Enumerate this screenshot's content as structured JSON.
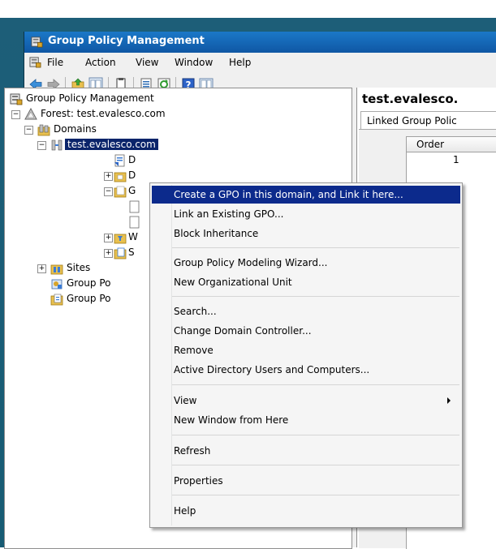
{
  "window": {
    "title": "Group Policy Management"
  },
  "menubar": {
    "items": [
      "File",
      "Action",
      "View",
      "Window",
      "Help"
    ]
  },
  "toolbar": {
    "buttons": [
      "back-icon",
      "forward-icon",
      "up-folder-icon",
      "show-hide-tree-icon",
      "clipboard-icon",
      "export-list-icon",
      "refresh-icon",
      "help-icon",
      "show-action-pane-icon"
    ]
  },
  "tree": {
    "root": "Group Policy Management",
    "forest": "Forest: test.evalesco.com",
    "domains": "Domains",
    "domain_selected": "test.evalesco.com",
    "child1": "D",
    "child2": "D",
    "child3": "G",
    "child6": "W",
    "child7": "S",
    "sites": "Sites",
    "gp_modeling": "Group Po",
    "gp_results": "Group Po"
  },
  "right_pane": {
    "title": "test.evalesco.",
    "tab": "Linked Group Polic",
    "col_order": "Order",
    "row1_order": "1"
  },
  "context_menu": {
    "items": [
      "Create a GPO in this domain, and Link it here...",
      "Link an Existing GPO...",
      "Block Inheritance",
      "Group Policy Modeling Wizard...",
      "New Organizational Unit",
      "Search...",
      "Change Domain Controller...",
      "Remove",
      "Active Directory Users and Computers...",
      "View",
      "New Window from Here",
      "Refresh",
      "Properties",
      "Help"
    ]
  },
  "colors": {
    "selection": "#0c2a8c",
    "titlebar": "#1467b8",
    "desktop": "#1a5e77"
  }
}
